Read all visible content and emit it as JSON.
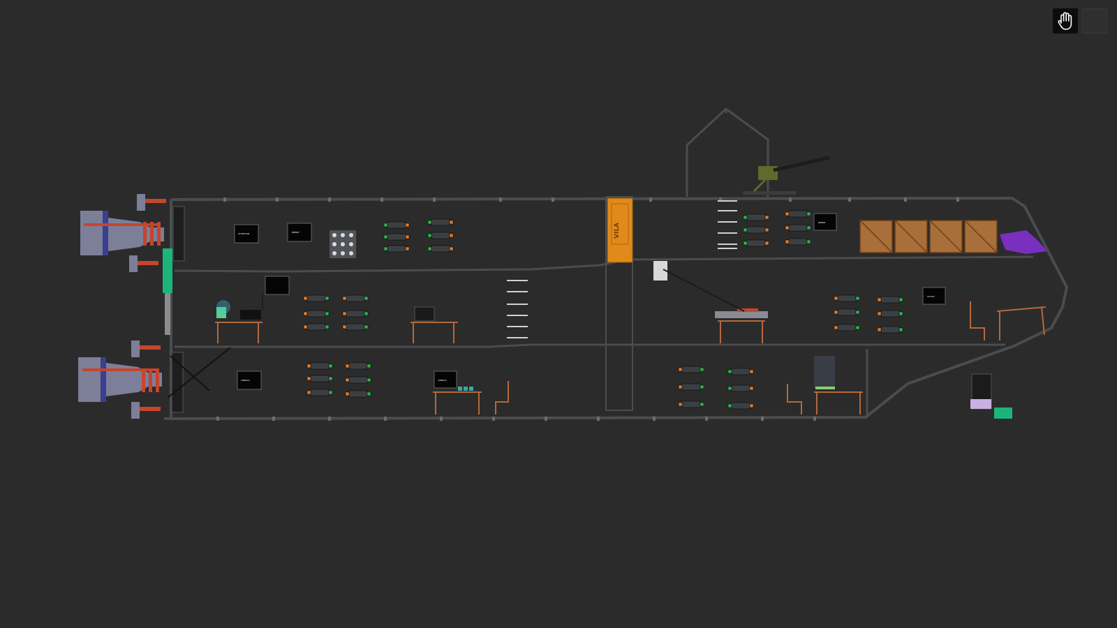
{
  "toolbar": {
    "hand_tool_icon": "hand-icon",
    "secondary_tool_icon": "dark-square-icon"
  },
  "ship": {
    "hull_color": "#4a4d4f",
    "background_color": "#2b2b2b",
    "door_color": "#e08a1a",
    "door_label": "VILA",
    "crate_color": "#a86f3a",
    "chair_color": "#b5683a",
    "engine_color": "#7d7f99",
    "engine_stripe_color": "#c5452d",
    "plant_color": "#7a2fbf",
    "green_device_color": "#1bb57b"
  },
  "screens": {
    "upper_1": "ATTENTION",
    "upper_2": "REPORT",
    "upper_3": "REPORT",
    "mid_right": "STATUS",
    "lower_left": "CONSOLE",
    "lower_mid": "CONSOLE"
  }
}
